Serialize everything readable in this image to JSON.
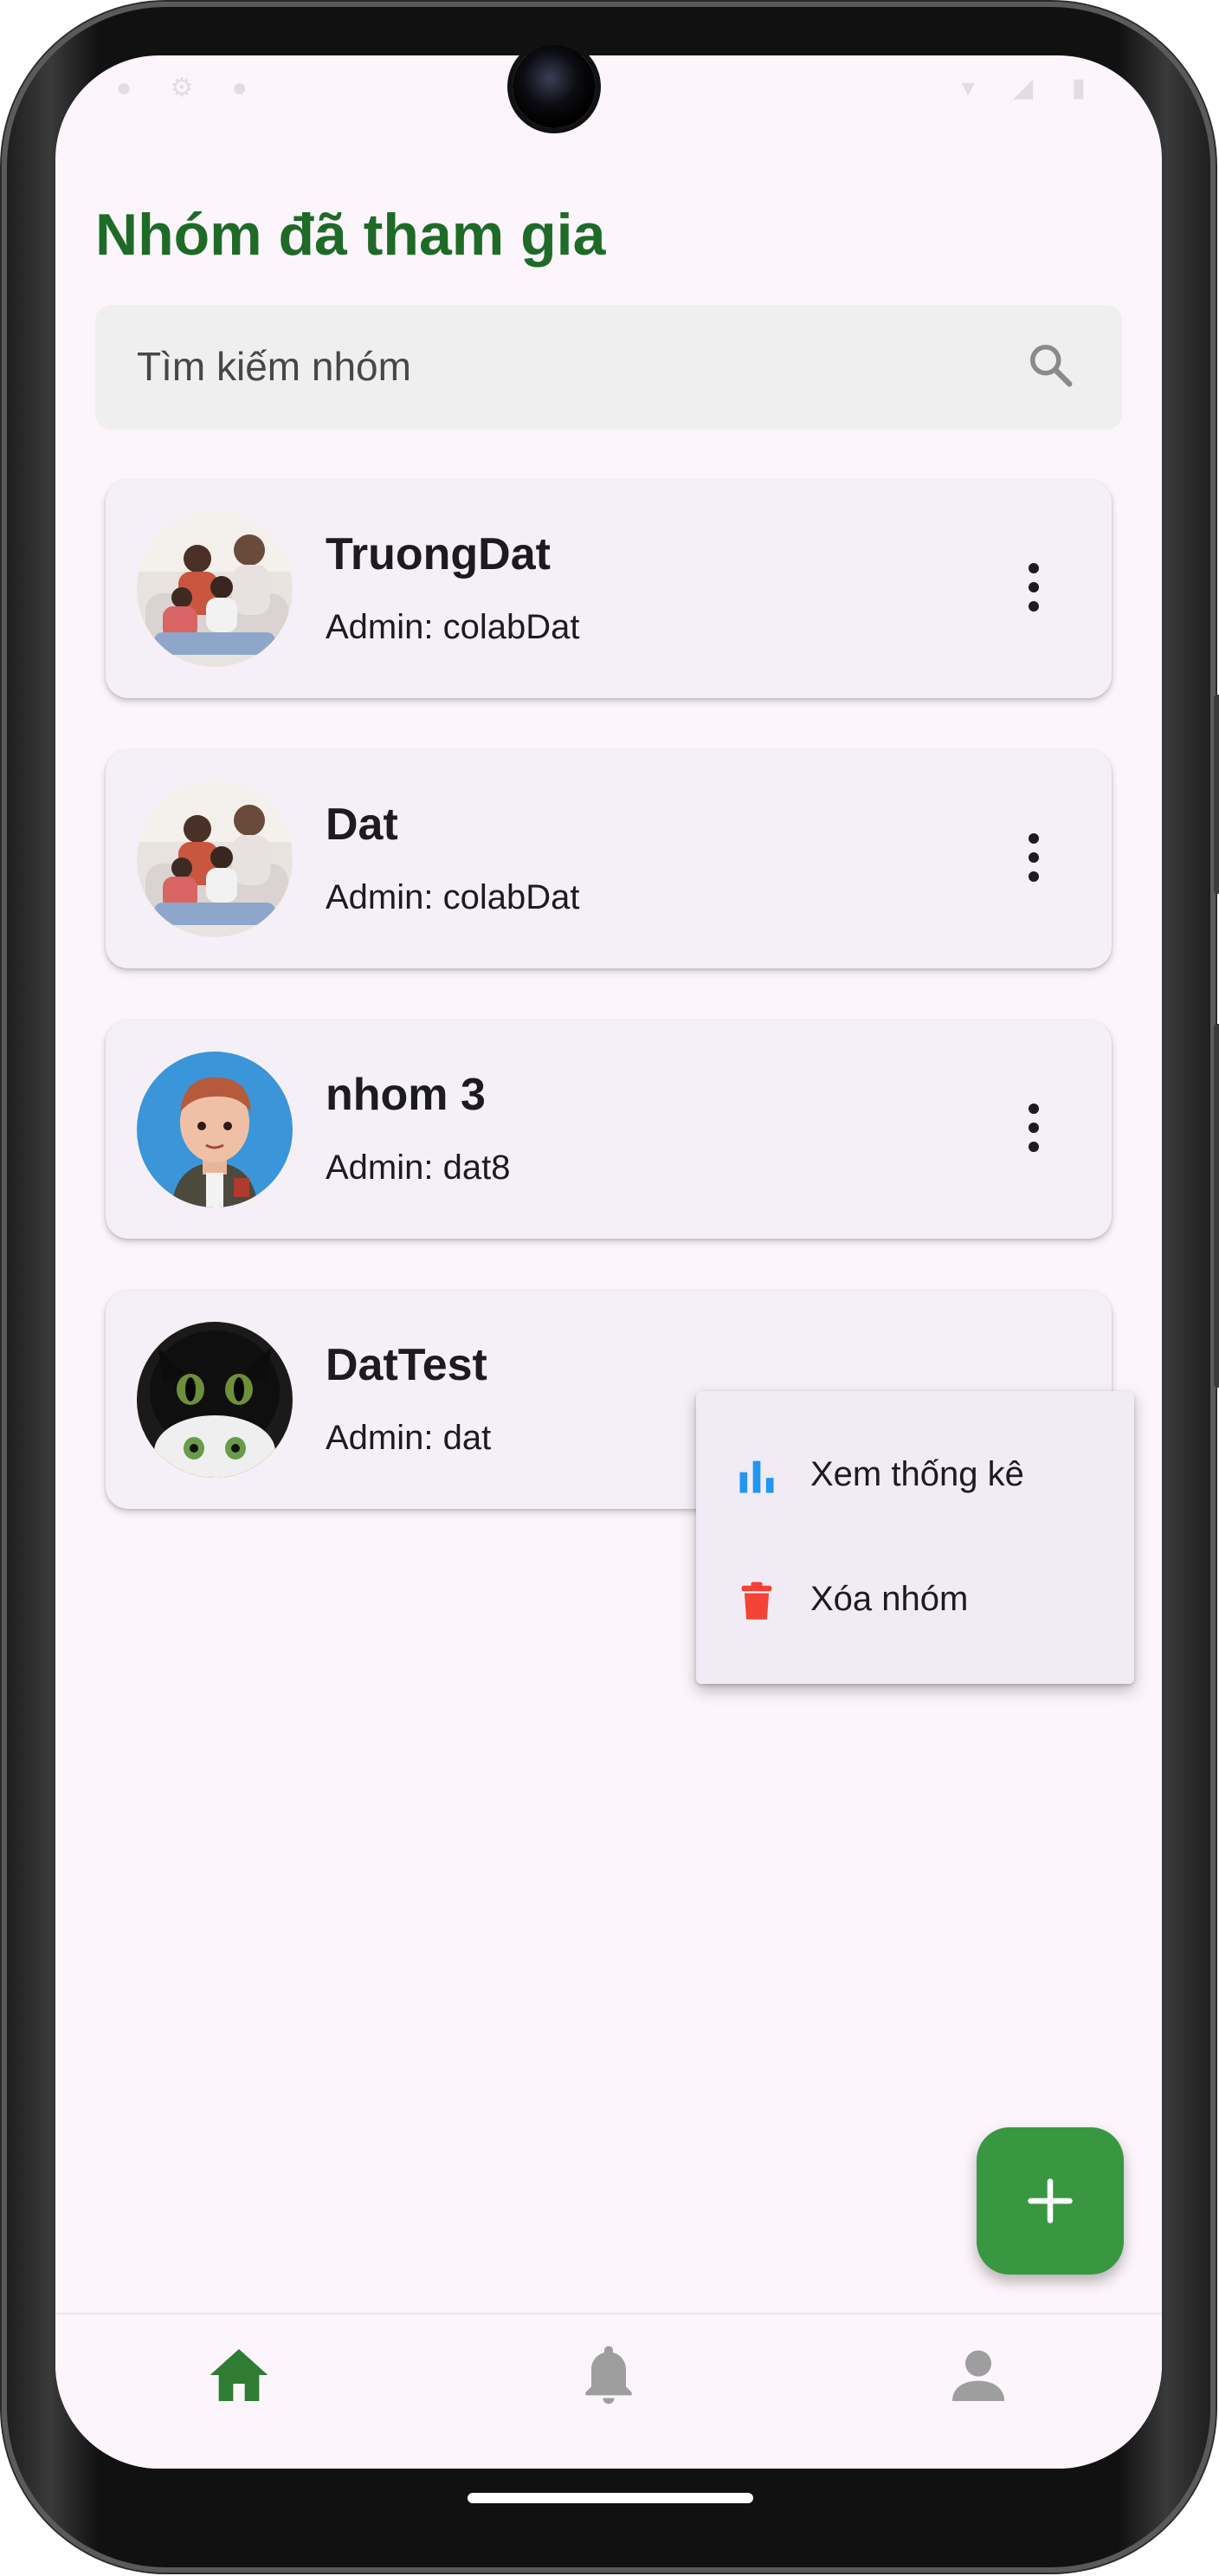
{
  "app": {
    "title": "Nhóm đã tham gia"
  },
  "search": {
    "placeholder": "Tìm kiếm nhóm",
    "icon": "search-icon"
  },
  "groups": [
    {
      "name": "TruongDat",
      "admin": "Admin: colabDat",
      "avatar": "family-photo"
    },
    {
      "name": "Dat",
      "admin": "Admin: colabDat",
      "avatar": "family-photo"
    },
    {
      "name": "nhom 3",
      "admin": "Admin: dat8",
      "avatar": "boy-3d-avatar"
    },
    {
      "name": "DatTest",
      "admin": "Admin: dat",
      "avatar": "black-cat-photo"
    }
  ],
  "popup_menu": {
    "items": [
      {
        "label": "Xem thống kê",
        "icon": "bar-chart-icon",
        "color": "#2196f3"
      },
      {
        "label": "Xóa nhóm",
        "icon": "trash-icon",
        "color": "#f44336"
      }
    ]
  },
  "fab": {
    "icon": "plus-icon",
    "color": "#3a9741"
  },
  "bottom_nav": {
    "items": [
      {
        "icon": "home-icon",
        "active": true,
        "color": "#2e7d32"
      },
      {
        "icon": "bell-icon",
        "active": false,
        "color": "#9e9e9e"
      },
      {
        "icon": "person-icon",
        "active": false,
        "color": "#9e9e9e"
      }
    ]
  },
  "colors": {
    "title": "#1e6b28",
    "background": "#fcf5fb",
    "card": "#f5f0f7"
  }
}
